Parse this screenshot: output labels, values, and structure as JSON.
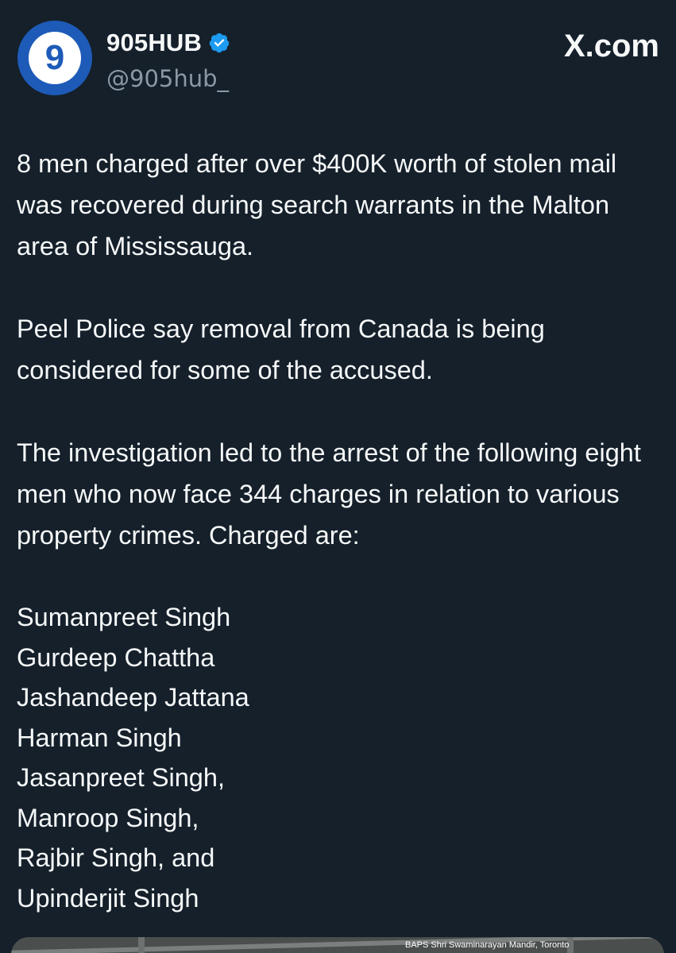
{
  "account": {
    "display_name": "905HUB",
    "handle": "@905hub_",
    "avatar_text": "9",
    "verified_icon": "verified-badge-icon",
    "verified_color": "#1d9bf0",
    "avatar_color": "#1e5bb8"
  },
  "brand": {
    "label": "X.com"
  },
  "tweet": {
    "paragraphs": [
      "8 men charged after over $400K worth of stolen mail was recovered during search warrants in the Malton area of Mississauga.",
      "Peel Police say removal from Canada is being considered for some of the accused.",
      "The investigation led to the arrest of the following eight men who now face 344 charges in relation to various property crimes. Charged are:"
    ],
    "names": [
      "Sumanpreet Singh",
      "Gurdeep Chattha",
      "Jashandeep Jattana",
      "Harman Singh",
      "Jasanpreet Singh,",
      "Manroop Singh,",
      "Rajbir Singh, and",
      "Upinderjit Singh"
    ]
  },
  "media": {
    "map_label": "BAPS Shri Swaminarayan Mandir, Toronto"
  },
  "colors": {
    "background": "#15202b",
    "text": "#f7f9f9",
    "secondary_text": "#8b98a5"
  }
}
